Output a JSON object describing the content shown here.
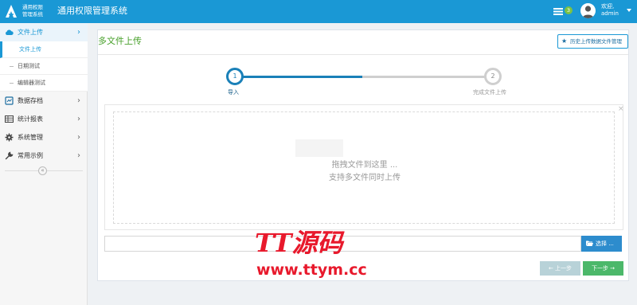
{
  "header": {
    "logo_line1": "通用权限",
    "logo_line2": "管理系统",
    "app_title": "通用权限管理系统",
    "message_count": "3",
    "user_greeting": "欢迎,",
    "user_name": "admin"
  },
  "sidebar": {
    "items": [
      {
        "label": "文件上传",
        "icon": "cloud-icon",
        "active": true,
        "children": [
          {
            "label": "文件上传",
            "current": true
          },
          {
            "label": "日期测试"
          },
          {
            "label": "编辑器测试"
          }
        ]
      },
      {
        "label": "数据存档",
        "icon": "database-icon"
      },
      {
        "label": "统计报表",
        "icon": "table-icon"
      },
      {
        "label": "系统管理",
        "icon": "gear-icon"
      },
      {
        "label": "常用示例",
        "icon": "wrench-icon"
      }
    ],
    "collapse_glyph": "«"
  },
  "main": {
    "title": "多文件上传",
    "history_button": "历史上传数据文件管理",
    "steps": [
      {
        "number": "1",
        "label": "导入",
        "status": "active"
      },
      {
        "number": "2",
        "label": "完成文件上传",
        "status": "pending"
      }
    ],
    "dropzone": {
      "line1": "拖拽文件到这里 ...",
      "line2": "支持多文件同时上传",
      "close_glyph": "×"
    },
    "file_input_value": "",
    "choose_button": "选择 ...",
    "prev_button": "← 上一步",
    "next_button": "下一步 →"
  },
  "watermark": {
    "brand": "TT源码",
    "url": "www.ttym.cc"
  },
  "colors": {
    "header_bg": "#1a98d5",
    "accent_green": "#47a02a",
    "step_active": "#1a80b8",
    "next_button": "#4cb86a",
    "watermark": "#e8192c"
  }
}
